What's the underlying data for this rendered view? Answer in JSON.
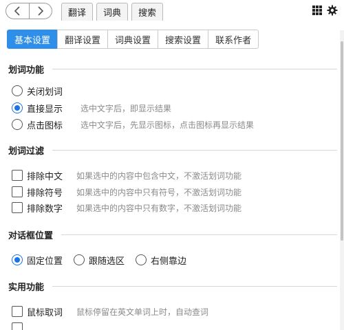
{
  "toolbar": {
    "tabs": [
      "翻译",
      "词典",
      "搜索"
    ],
    "grid_icon": "grid-icon",
    "settings_icon": "gear-icon"
  },
  "settings_tabs": [
    "基本设置",
    "翻译设置",
    "词典设置",
    "搜索设置",
    "联系作者"
  ],
  "active_tab": "基本设置",
  "sections": {
    "select_word": {
      "title": "划词功能",
      "options": [
        {
          "label": "关闭划词",
          "desc": "",
          "checked": false
        },
        {
          "label": "直接显示",
          "desc": "选中文字后，即显示结果",
          "checked": true
        },
        {
          "label": "点击图标",
          "desc": "选中文字后，先显示图标，点击图标再显示结果",
          "checked": false
        }
      ]
    },
    "filter": {
      "title": "划词过滤",
      "options": [
        {
          "label": "排除中文",
          "desc": "如果选中的内容中包含中文，不激活划词功能",
          "checked": false
        },
        {
          "label": "排除符号",
          "desc": "如果选中的内容中只有符号，不激活划词功能",
          "checked": false
        },
        {
          "label": "排除数字",
          "desc": "如果选中的内容中只有数字，不激活划词功能",
          "checked": false
        }
      ]
    },
    "dialog_position": {
      "title": "对话框位置",
      "options": [
        {
          "label": "固定位置",
          "checked": true
        },
        {
          "label": "跟随选区",
          "checked": false
        },
        {
          "label": "右侧靠边",
          "checked": false
        }
      ]
    },
    "utility": {
      "title": "实用功能",
      "options": [
        {
          "label": "鼠标取词",
          "desc": "鼠标停留在英文单词上时，自动查词",
          "checked": false
        }
      ]
    }
  },
  "colors": {
    "accent": "#2f8fe8",
    "radio_checked": "#1a73e8",
    "desc_text": "#8a8a8a"
  }
}
